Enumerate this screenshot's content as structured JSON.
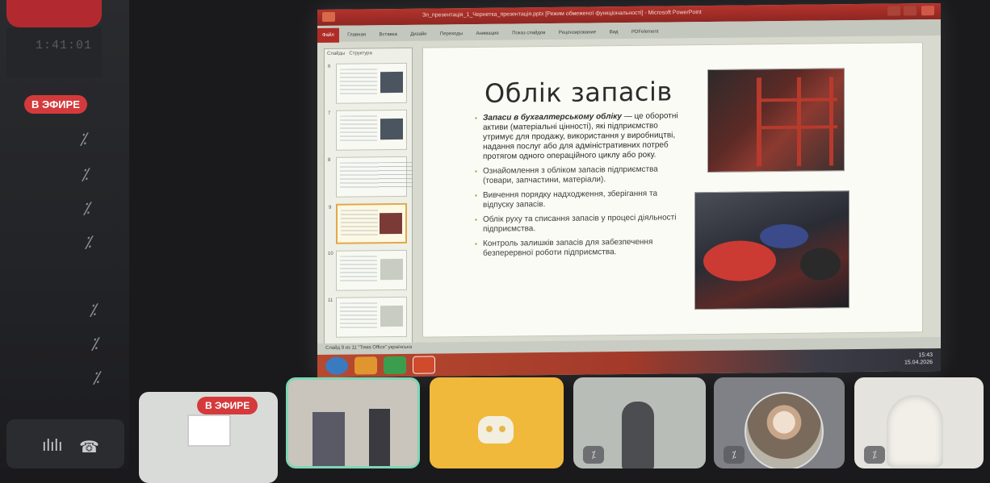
{
  "sidebar": {
    "timer": "1:41:01",
    "live_badge": "В ЭФИРЕ",
    "mic_off_glyph": "⁒",
    "controls": {
      "voice_icon": "ılılı",
      "hangup_icon": "☎"
    }
  },
  "presentation": {
    "window_title": "Зп_презентація_1_Чернетка_презентація.pptx [Режим обмеженої функціональності] - Microsoft PowerPoint",
    "ribbon_tabs": [
      "Файл",
      "Главная",
      "Вставка",
      "Дизайн",
      "Переходы",
      "Анимация",
      "Показ слайдов",
      "Рецензирование",
      "Вид",
      "PDFelement"
    ],
    "thumb_tabs": [
      "Слайды",
      "Структура"
    ],
    "thumb_numbers": [
      "6",
      "7",
      "8",
      "9",
      "10",
      "11"
    ],
    "slide": {
      "title": "Облік запасів",
      "bullets": [
        {
          "bold": "Запаси в бухгалтерському обліку",
          "text": " — це оборотні активи (матеріальні цінності), які підприємство утримує для продажу, використання у виробництві, надання послуг або для адміністративних потреб протягом одного операційного циклу або року."
        },
        {
          "bold": "",
          "text": "Ознайомлення з обліком запасів підприємства (товари, запчастини, матеріали)."
        },
        {
          "bold": "",
          "text": "Вивчення порядку надходження, зберігання та відпуску запасів."
        },
        {
          "bold": "",
          "text": "Облік руху та списання запасів у процесі діяльності підприємства."
        },
        {
          "bold": "",
          "text": "Контроль залишків запасів для забезпечення безперервної роботи підприємства."
        }
      ]
    },
    "status_left": "Слайд 9 из 11   \"Тема Office\"   українська",
    "clock_time": "15:43",
    "clock_date": "15.04.2026"
  },
  "tiles": {
    "live_badge": "В ЭФИРЕ",
    "mic_muted_glyph": "⁒"
  }
}
